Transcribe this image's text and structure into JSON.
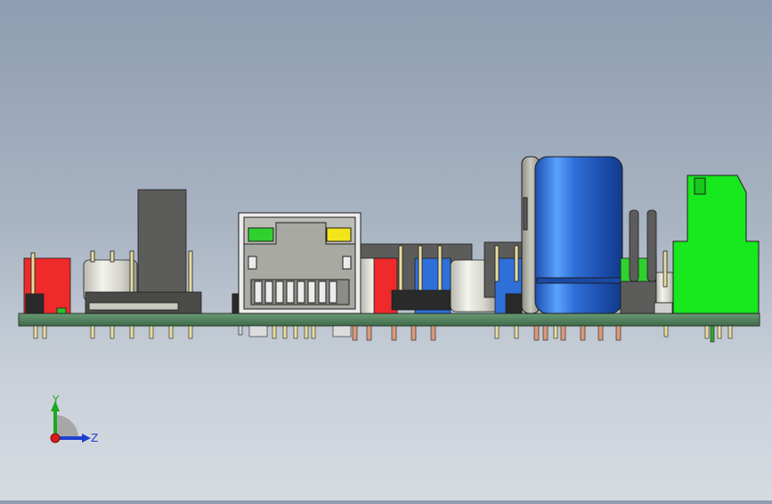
{
  "window": {
    "title": ""
  },
  "scene": {
    "description_hidden": false,
    "colors": {
      "background_top": "#8e9db1",
      "background_bottom": "#d6dbe1",
      "pcb": "#4f7a5a",
      "red_header": "#ee2a2a",
      "rj45_body": "#ececec",
      "rj45_led_left": "#2fd12f",
      "rj45_led_right": "#f2e51a",
      "electrolytic_cap": "#2f6fd8",
      "terminal_block": "#18e81e",
      "pins_gold": "#e7dca0",
      "pins_copper": "#d99a7a"
    }
  },
  "triad": {
    "y_label": "Y",
    "z_label": "Z",
    "y_color": "#1fa81f",
    "z_color": "#1e3fd0",
    "origin_color": "#d81c1c"
  }
}
